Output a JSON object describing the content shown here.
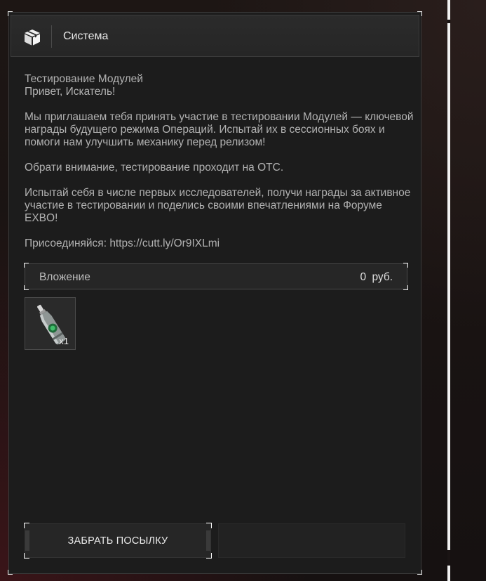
{
  "header": {
    "title": "Система",
    "icon": "package-box-icon"
  },
  "message": {
    "subject": "Тестирование Модулей",
    "greeting": "Привет, Искатель!",
    "paragraph1": "Мы приглашаем тебя принять участие в тестировании Модулей — ключевой награды будущего режима Операций. Испытай их в сессионных боях и помоги нам улучшить механику перед релизом!",
    "paragraph2": "Обрати внимание, тестирование проходит на ОТС.",
    "paragraph3": "Испытай себя в числе первых исследователей, получи награды за активное участие в тестировании и поделись своими впечатлениями на Форуме EXBO!",
    "paragraph4": "Присоединяйся: https://cutt.ly/Or9IXLmi"
  },
  "attachment": {
    "label": "Вложение",
    "value": "0 руб.",
    "items": [
      {
        "icon": "bottle-item-icon",
        "quantity": "x1"
      }
    ]
  },
  "actions": {
    "claim_label": "ЗАБРАТЬ ПОСЫЛКУ"
  },
  "colors": {
    "background": "#1c1c1c",
    "header": "#2b2b2b",
    "text": "#b2b2b2",
    "accent_white": "#ffffff"
  }
}
